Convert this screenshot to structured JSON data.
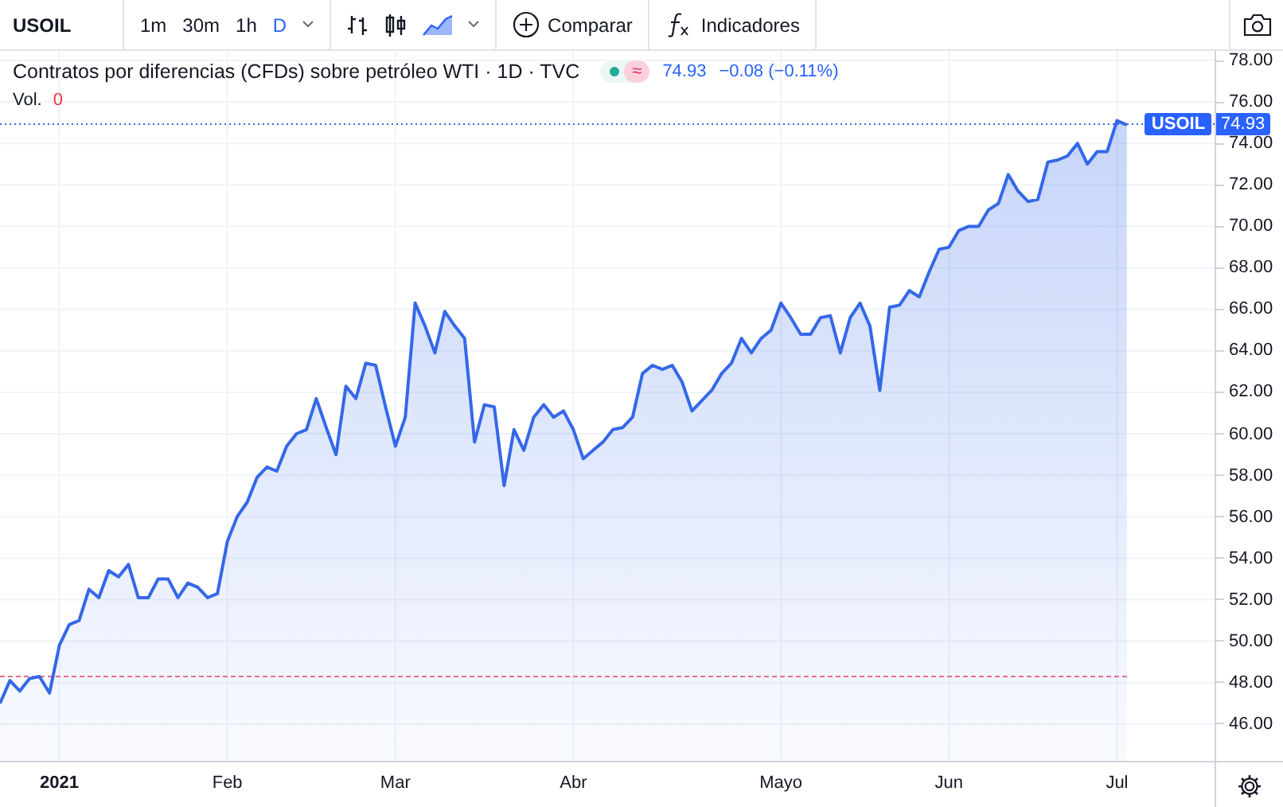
{
  "toolbar": {
    "symbol": "USOIL",
    "intervals": [
      {
        "label": "1m",
        "selected": false
      },
      {
        "label": "30m",
        "selected": false
      },
      {
        "label": "1h",
        "selected": false
      },
      {
        "label": "D",
        "selected": true
      }
    ],
    "chart_types": [
      {
        "kind": "bars",
        "selected": false
      },
      {
        "kind": "candles",
        "selected": false
      },
      {
        "kind": "area",
        "selected": true
      }
    ],
    "compare_label": "Comparar",
    "indicators_label": "Indicadores"
  },
  "legend": {
    "title": "Contratos por diferencias (CFDs) sobre petróleo WTI · 1D · TVC",
    "badge": "≈",
    "price": "74.93",
    "change": "−0.08 (−0.11%)",
    "volume_label": "Vol.",
    "volume": "0"
  },
  "chart_data": {
    "type": "area",
    "grid": true,
    "ylim": [
      44.23,
      78.46
    ],
    "yticks": [
      {
        "value": 46,
        "label": "46.00"
      },
      {
        "value": 48,
        "label": "48.00"
      },
      {
        "value": 50,
        "label": "50.00"
      },
      {
        "value": 52,
        "label": "52.00"
      },
      {
        "value": 54,
        "label": "54.00"
      },
      {
        "value": 56,
        "label": "56.00"
      },
      {
        "value": 58,
        "label": "58.00"
      },
      {
        "value": 60,
        "label": "60.00"
      },
      {
        "value": 62,
        "label": "62.00"
      },
      {
        "value": 64,
        "label": "64.00"
      },
      {
        "value": 66,
        "label": "66.00"
      },
      {
        "value": 68,
        "label": "68.00"
      },
      {
        "value": 70,
        "label": "70.00"
      },
      {
        "value": 72,
        "label": "72.00"
      },
      {
        "value": 74,
        "label": "74.00"
      },
      {
        "value": 76,
        "label": "76.00"
      },
      {
        "value": 78,
        "label": "78.00"
      }
    ],
    "categories": [
      null,
      null,
      null,
      null,
      null,
      null,
      "2021",
      null,
      null,
      null,
      null,
      null,
      null,
      null,
      null,
      null,
      null,
      null,
      null,
      null,
      null,
      null,
      null,
      "Feb",
      null,
      null,
      null,
      null,
      null,
      null,
      null,
      null,
      null,
      null,
      null,
      null,
      null,
      null,
      null,
      null,
      "Mar",
      null,
      null,
      null,
      null,
      null,
      null,
      null,
      null,
      null,
      null,
      null,
      null,
      null,
      null,
      null,
      null,
      null,
      "Abr",
      null,
      null,
      null,
      null,
      null,
      null,
      null,
      null,
      null,
      null,
      null,
      null,
      null,
      null,
      null,
      null,
      null,
      null,
      null,
      null,
      "Mayo",
      null,
      null,
      null,
      null,
      null,
      null,
      null,
      null,
      null,
      null,
      null,
      null,
      null,
      null,
      null,
      null,
      "Jun",
      null,
      null,
      null,
      null,
      null,
      null,
      null,
      null,
      null,
      null,
      null,
      null,
      null,
      null,
      null,
      null,
      "Jul",
      null
    ],
    "series": [
      {
        "name": "USOIL",
        "color": "#3568e8",
        "values": [
          47.0,
          48.1,
          47.6,
          48.2,
          48.3,
          47.5,
          49.8,
          50.8,
          51.0,
          52.5,
          52.1,
          53.4,
          53.1,
          53.7,
          52.1,
          52.1,
          53.0,
          53.0,
          52.1,
          52.8,
          52.6,
          52.1,
          52.3,
          54.8,
          56.0,
          56.7,
          57.9,
          58.4,
          58.2,
          59.4,
          60.0,
          60.2,
          61.7,
          60.3,
          59.0,
          62.3,
          61.7,
          63.4,
          63.3,
          61.3,
          59.4,
          60.8,
          66.3,
          65.2,
          63.9,
          65.9,
          65.2,
          64.6,
          59.6,
          61.4,
          61.3,
          57.5,
          60.2,
          59.2,
          60.8,
          61.4,
          60.8,
          61.1,
          60.2,
          58.8,
          59.2,
          59.6,
          60.2,
          60.3,
          60.8,
          62.9,
          63.3,
          63.1,
          63.3,
          62.5,
          61.1,
          61.6,
          62.1,
          62.9,
          63.4,
          64.6,
          63.9,
          64.6,
          65.0,
          66.3,
          65.6,
          64.8,
          64.8,
          65.6,
          65.7,
          63.9,
          65.6,
          66.3,
          65.2,
          62.1,
          66.1,
          66.2,
          66.9,
          66.6,
          67.8,
          68.9,
          69.0,
          69.8,
          70.0,
          70.0,
          70.8,
          71.1,
          72.5,
          71.7,
          71.2,
          71.3,
          73.1,
          73.2,
          73.4,
          74.0,
          73.0,
          73.6,
          73.6,
          75.1,
          74.9
        ]
      }
    ],
    "ref_lines": [
      {
        "axis": "y",
        "value": 48.3
      },
      {
        "axis": "y",
        "value": 74.93,
        "label": "74.93"
      }
    ]
  }
}
